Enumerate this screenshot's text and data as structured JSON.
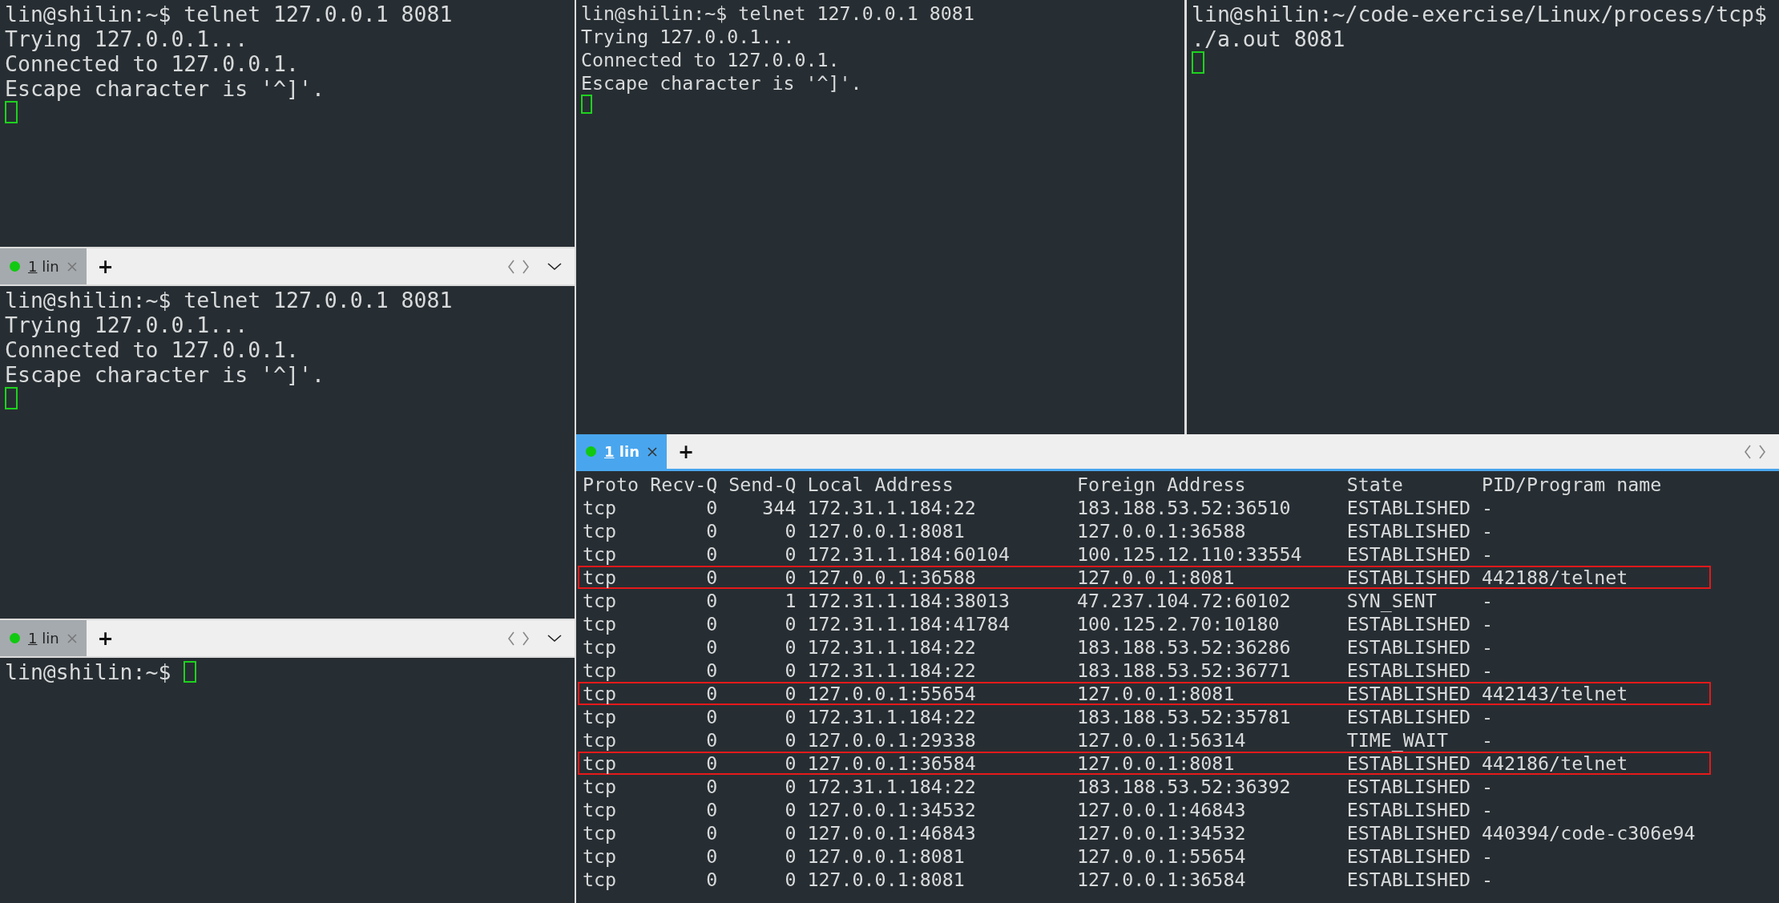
{
  "left": {
    "top_terminal": {
      "lines": [
        "lin@shilin:~$ telnet 127.0.0.1 8081",
        "Trying 127.0.0.1...",
        "Connected to 127.0.0.1.",
        "Escape character is '^]'."
      ],
      "cursor_after_text": false
    },
    "split_1": {
      "focused": false,
      "tabs": [
        {
          "label": "1 lin",
          "selected": true
        }
      ],
      "new_tab": "+",
      "menu": true,
      "terminal": {
        "lines": [
          "lin@shilin:~$ telnet 127.0.0.1 8081",
          "Trying 127.0.0.1...",
          "Connected to 127.0.0.1.",
          "Escape character is '^]'."
        ],
        "cursor_after_text": false
      }
    },
    "split_2": {
      "focused": false,
      "tabs": [
        {
          "label": "1 lin",
          "selected": true
        }
      ],
      "new_tab": "+",
      "menu": true,
      "terminal": {
        "lines": [
          "lin@shilin:~$ "
        ],
        "cursor_after_text": true
      }
    }
  },
  "right": {
    "top_left_terminal": {
      "lines": [
        "lin@shilin:~$ telnet 127.0.0.1 8081",
        "Trying 127.0.0.1...",
        "Connected to 127.0.0.1.",
        "Escape character is '^]'."
      ],
      "cursor_after_text": false
    },
    "top_right_terminal": {
      "lines": [
        "lin@shilin:~/code-exercise/Linux/process/tcp$",
        "./a.out 8081"
      ],
      "cursor_after_text": false
    },
    "split": {
      "focused": true,
      "tabs": [
        {
          "label": "1 lin",
          "selected": true
        }
      ],
      "new_tab": "+",
      "menu": false,
      "netstat": {
        "columns": [
          "Proto",
          "Recv-Q",
          "Send-Q",
          "Local Address",
          "Foreign Address",
          "State",
          "PID/Program name"
        ],
        "rows": [
          {
            "cells": [
              "tcp",
              "0",
              "344",
              "172.31.1.184:22",
              "183.188.53.52:36510",
              "ESTABLISHED",
              "-"
            ],
            "highlighted": false
          },
          {
            "cells": [
              "tcp",
              "0",
              "0",
              "127.0.0.1:8081",
              "127.0.0.1:36588",
              "ESTABLISHED",
              "-"
            ],
            "highlighted": false
          },
          {
            "cells": [
              "tcp",
              "0",
              "0",
              "172.31.1.184:60104",
              "100.125.12.110:33554",
              "ESTABLISHED",
              "-"
            ],
            "highlighted": false
          },
          {
            "cells": [
              "tcp",
              "0",
              "0",
              "127.0.0.1:36588",
              "127.0.0.1:8081",
              "ESTABLISHED",
              "442188/telnet"
            ],
            "highlighted": true
          },
          {
            "cells": [
              "tcp",
              "0",
              "1",
              "172.31.1.184:38013",
              "47.237.104.72:60102",
              "SYN_SENT",
              "-"
            ],
            "highlighted": false
          },
          {
            "cells": [
              "tcp",
              "0",
              "0",
              "172.31.1.184:41784",
              "100.125.2.70:10180",
              "ESTABLISHED",
              "-"
            ],
            "highlighted": false
          },
          {
            "cells": [
              "tcp",
              "0",
              "0",
              "172.31.1.184:22",
              "183.188.53.52:36286",
              "ESTABLISHED",
              "-"
            ],
            "highlighted": false
          },
          {
            "cells": [
              "tcp",
              "0",
              "0",
              "172.31.1.184:22",
              "183.188.53.52:36771",
              "ESTABLISHED",
              "-"
            ],
            "highlighted": false
          },
          {
            "cells": [
              "tcp",
              "0",
              "0",
              "127.0.0.1:55654",
              "127.0.0.1:8081",
              "ESTABLISHED",
              "442143/telnet"
            ],
            "highlighted": true
          },
          {
            "cells": [
              "tcp",
              "0",
              "0",
              "172.31.1.184:22",
              "183.188.53.52:35781",
              "ESTABLISHED",
              "-"
            ],
            "highlighted": false
          },
          {
            "cells": [
              "tcp",
              "0",
              "0",
              "127.0.0.1:29338",
              "127.0.0.1:56314",
              "TIME_WAIT",
              "-"
            ],
            "highlighted": false
          },
          {
            "cells": [
              "tcp",
              "0",
              "0",
              "127.0.0.1:36584",
              "127.0.0.1:8081",
              "ESTABLISHED",
              "442186/telnet"
            ],
            "highlighted": true
          },
          {
            "cells": [
              "tcp",
              "0",
              "0",
              "172.31.1.184:22",
              "183.188.53.52:36392",
              "ESTABLISHED",
              "-"
            ],
            "highlighted": false
          },
          {
            "cells": [
              "tcp",
              "0",
              "0",
              "127.0.0.1:34532",
              "127.0.0.1:46843",
              "ESTABLISHED",
              "-"
            ],
            "highlighted": false
          },
          {
            "cells": [
              "tcp",
              "0",
              "0",
              "127.0.0.1:46843",
              "127.0.0.1:34532",
              "ESTABLISHED",
              "440394/code-c306e94"
            ],
            "highlighted": false
          },
          {
            "cells": [
              "tcp",
              "0",
              "0",
              "127.0.0.1:8081",
              "127.0.0.1:55654",
              "ESTABLISHED",
              "-"
            ],
            "highlighted": false
          },
          {
            "cells": [
              "tcp",
              "0",
              "0",
              "127.0.0.1:8081",
              "127.0.0.1:36584",
              "ESTABLISHED",
              "-"
            ],
            "highlighted": false
          }
        ]
      }
    }
  }
}
